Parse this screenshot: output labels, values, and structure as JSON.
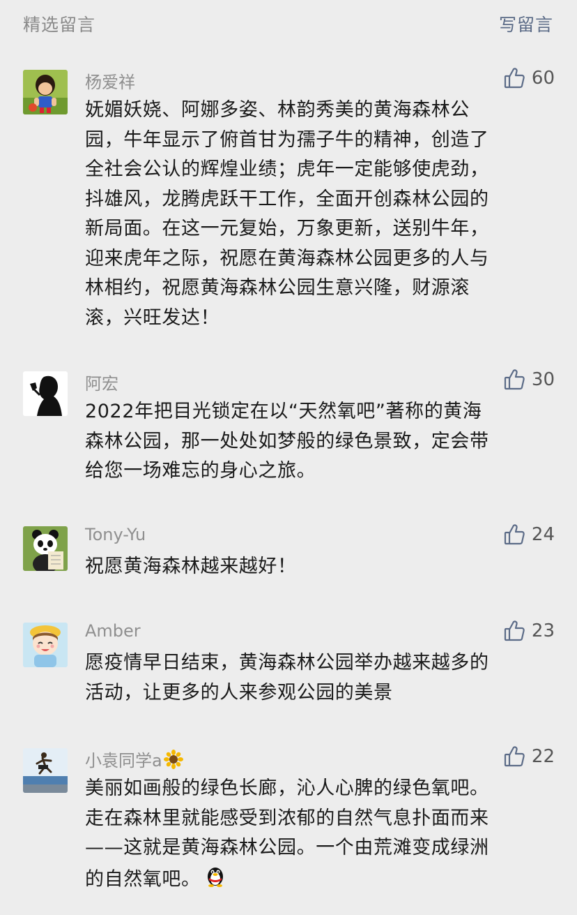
{
  "header": {
    "title": "精选留言",
    "action": "写留言"
  },
  "comments": [
    {
      "user": "杨爱祥",
      "likes": "60",
      "avatar_icon": "cartoon-boy-avatar-icon",
      "lines": [
        "妩媚妖娆、阿娜多姿、林韵秀美的黄海森林公",
        "园，牛年显示了俯首甘为孺子牛的精神，创造了",
        "全社会公认的辉煌业绩；虎年一定能够使虎劲，",
        "抖雄风，龙腾虎跃干工作，全面开创森林公园的",
        "新局面。在这一元复始，万象更新，送别牛年，",
        "迎来虎年之际，祝愿在黄海森林公园更多的人与",
        "林相约，祝愿黄海森林公园生意兴隆，财源滚",
        "滚，兴旺发达！"
      ]
    },
    {
      "user": "阿宏",
      "likes": "30",
      "avatar_icon": "silhouette-woman-avatar-icon",
      "lines": [
        "2022年把目光锁定在以“天然氧吧”著称的黄海",
        "森林公园，那一处处如梦般的绿色景致，定会带",
        "给您一场难忘的身心之旅。"
      ]
    },
    {
      "user": "Tony-Yu",
      "likes": "24",
      "avatar_icon": "panda-avatar-icon",
      "lines": [
        "祝愿黄海森林越来越好！"
      ]
    },
    {
      "user": "Amber",
      "likes": "23",
      "avatar_icon": "cartoon-girl-avatar-icon",
      "lines": [
        "愿疫情早日结束，黄海森林公园举办越来越多的",
        "活动，让更多的人来参观公园的美景"
      ]
    },
    {
      "user": "小袁同学a",
      "user_emoji": "sunflower-icon",
      "likes": "22",
      "avatar_icon": "runner-beach-avatar-icon",
      "lines": [
        "美丽如画般的绿色长廊，沁人心脾的绿色氧吧。",
        "走在森林里就能感受到浓郁的自然气息扑面而来",
        "——这就是黄海森林公园。一个由荒滩变成绿洲",
        "的自然氧吧。"
      ],
      "trailing_emoji": "qq-penguin-icon"
    }
  ],
  "like_icon": "thumbs-up-icon",
  "colors": {
    "background": "#ededed",
    "header_title": "#8a8a8a",
    "header_action": "#5b6b87",
    "username": "#8f8f8f",
    "body_text": "#1a1a1a"
  }
}
